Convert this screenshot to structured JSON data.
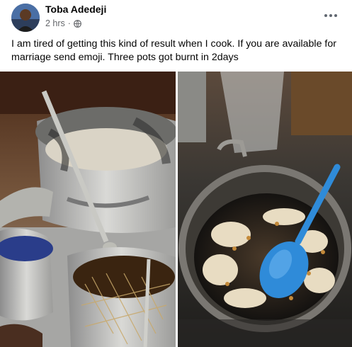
{
  "post": {
    "author": "Toba Adedeji",
    "time": "2 hrs",
    "separator": "·",
    "privacy_icon": "globe-icon",
    "more_icon": "more-options-icon",
    "text": "I am tired of getting this kind of result when I cook. If you are available for marriage send emoji. Three pots got burnt in 2days"
  },
  "photos": [
    {
      "name": "photo-burnt-pots-sink"
    },
    {
      "name": "photo-burnt-pot-blue-spoon"
    }
  ],
  "colors": {
    "name_text": "#050505",
    "meta_text": "#65676b",
    "spoon_blue": "#2f8bd9"
  }
}
